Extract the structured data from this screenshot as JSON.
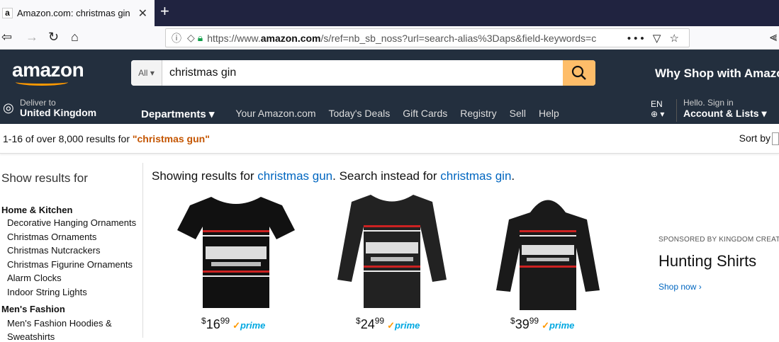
{
  "browser": {
    "tab_title": "Amazon.com: christmas gin",
    "favicon": "a",
    "url_domain_prefix": "https://www.",
    "url_domain": "amazon.com",
    "url_path": "/s/ref=nb_sb_noss?url=search-alias%3Daps&field-keywords=c",
    "more_icon": "•••"
  },
  "header": {
    "logo": "amazon",
    "search_category": "All",
    "search_value": "christmas gin",
    "why_shop": "Why Shop with Amazo",
    "deliver_to": "Deliver to",
    "deliver_location": "United Kingdom",
    "departments": "Departments",
    "nav_links": [
      "Your Amazon.com",
      "Today's Deals",
      "Gift Cards",
      "Registry",
      "Sell",
      "Help"
    ],
    "lang": "EN",
    "hello": "Hello. Sign in",
    "account": "Account & Lists"
  },
  "results": {
    "count_text": "1-16 of over 8,000 results for ",
    "query": "\"christmas gun\"",
    "sort_by": "Sort by"
  },
  "sidebar": {
    "title": "Show results for",
    "cat1": "Home & Kitchen",
    "cat1_items": [
      "Decorative Hanging Ornaments",
      "Christmas Ornaments",
      "Christmas Nutcrackers",
      "Christmas Figurine Ornaments",
      "Alarm Clocks",
      "Indoor String Lights"
    ],
    "cat2": "Men's Fashion",
    "cat2_items": [
      "Men's Fashion Hoodies &",
      "Sweatshirts"
    ]
  },
  "main": {
    "showing_prefix": "Showing results for ",
    "showing_term": "christmas gun",
    "instead_prefix": ". Search instead for ",
    "instead_term": "christmas gin",
    "instead_suffix": ".",
    "products": [
      {
        "currency": "$",
        "whole": "16",
        "fraction": "99",
        "prime": "prime"
      },
      {
        "currency": "$",
        "whole": "24",
        "fraction": "99",
        "prime": "prime"
      },
      {
        "currency": "$",
        "whole": "39",
        "fraction": "99",
        "prime": "prime"
      }
    ]
  },
  "sponsored": {
    "label": "SPONSORED BY KINGDOM CREATION",
    "title": "Hunting Shirts",
    "link": "Shop now ›"
  }
}
